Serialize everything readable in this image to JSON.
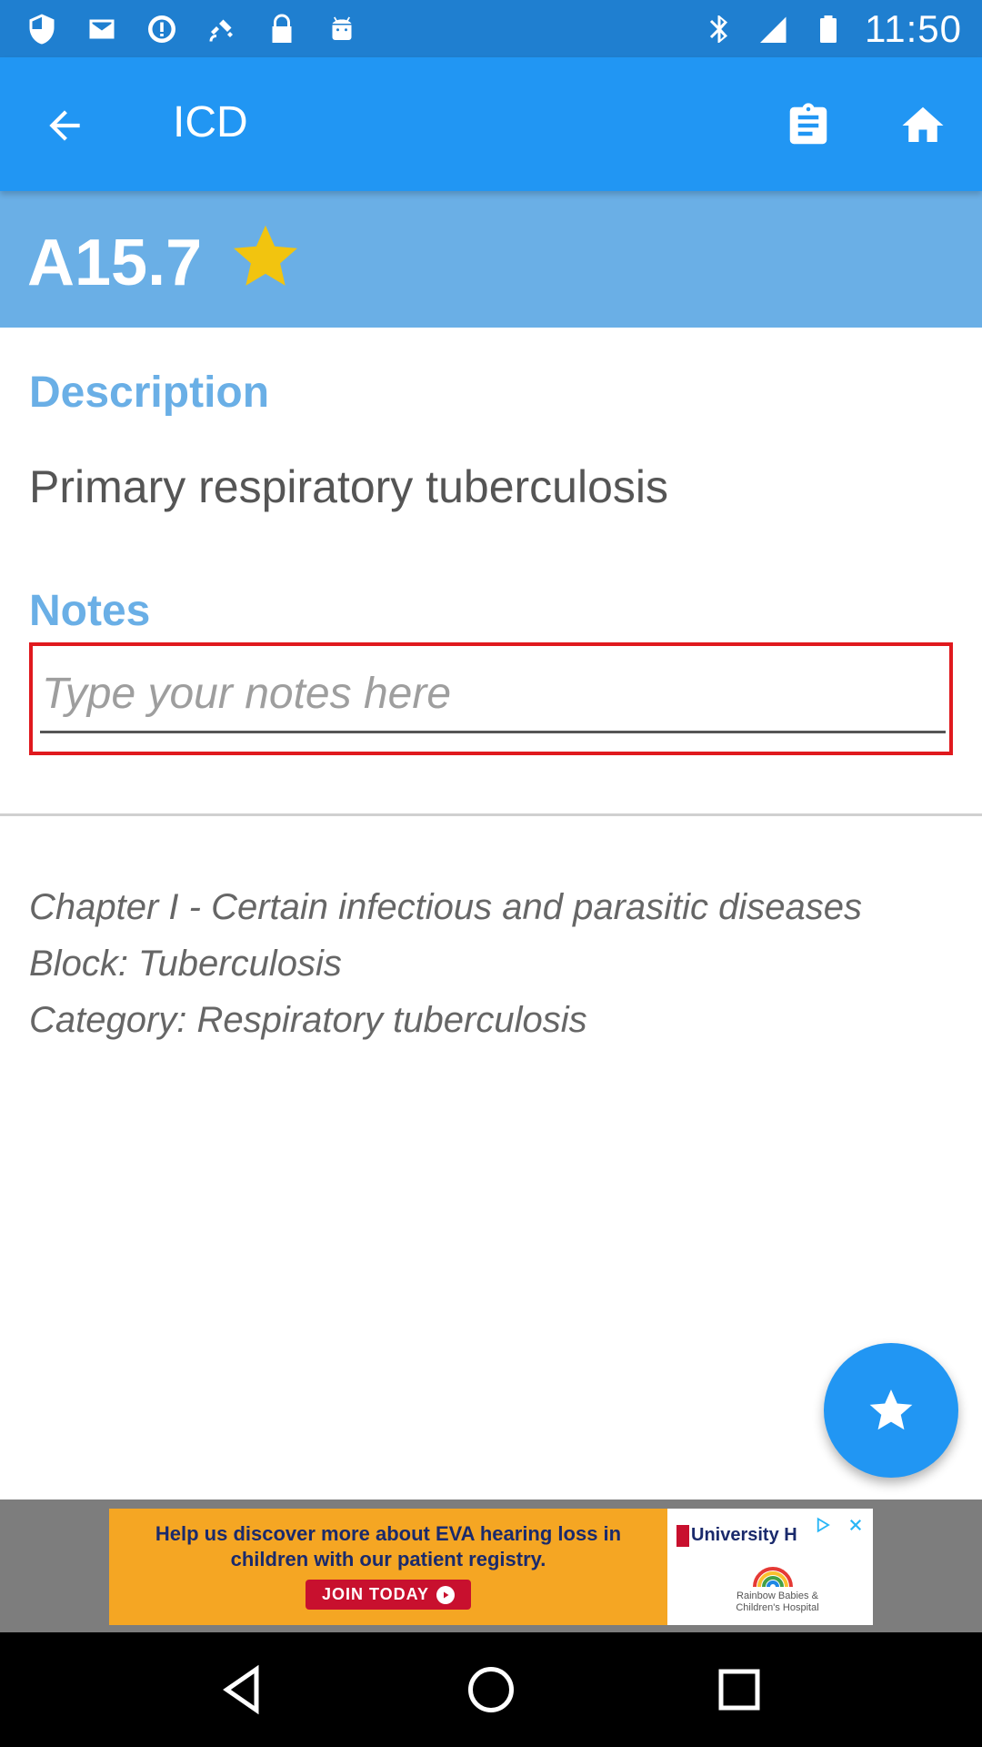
{
  "status_bar": {
    "time": "11:50",
    "left_icons": [
      "shield-icon",
      "mail-icon",
      "info-icon",
      "fake-gps-icon",
      "lock-icon",
      "android-icon"
    ],
    "right_icons": [
      "bluetooth-icon",
      "signal-icon",
      "battery-icon"
    ]
  },
  "app_bar": {
    "title": "ICD",
    "background": "#2196f3"
  },
  "code": {
    "value": "A15.7",
    "favorite": true,
    "header_background": "#6aafe6",
    "star_color": "#f2c40f"
  },
  "description": {
    "heading": "Description",
    "text": "Primary respiratory tuberculosis"
  },
  "notes": {
    "heading": "Notes",
    "placeholder": "Type your notes here",
    "value": ""
  },
  "hierarchy": {
    "chapter": "Chapter I - Certain infectious and parasitic diseases",
    "block": "Block: Tuberculosis",
    "category": "Category: Respiratory tuberculosis"
  },
  "ad": {
    "headline": "Help us discover more about EVA hearing loss in children with our patient registry.",
    "cta": "JOIN TODAY",
    "sponsor": "University H",
    "sponsor_sub": "Rainbow Babies & Children's Hospital"
  },
  "colors": {
    "accent": "#2196f3",
    "heading": "#6aafe6",
    "notes_outline": "#e0191e"
  }
}
